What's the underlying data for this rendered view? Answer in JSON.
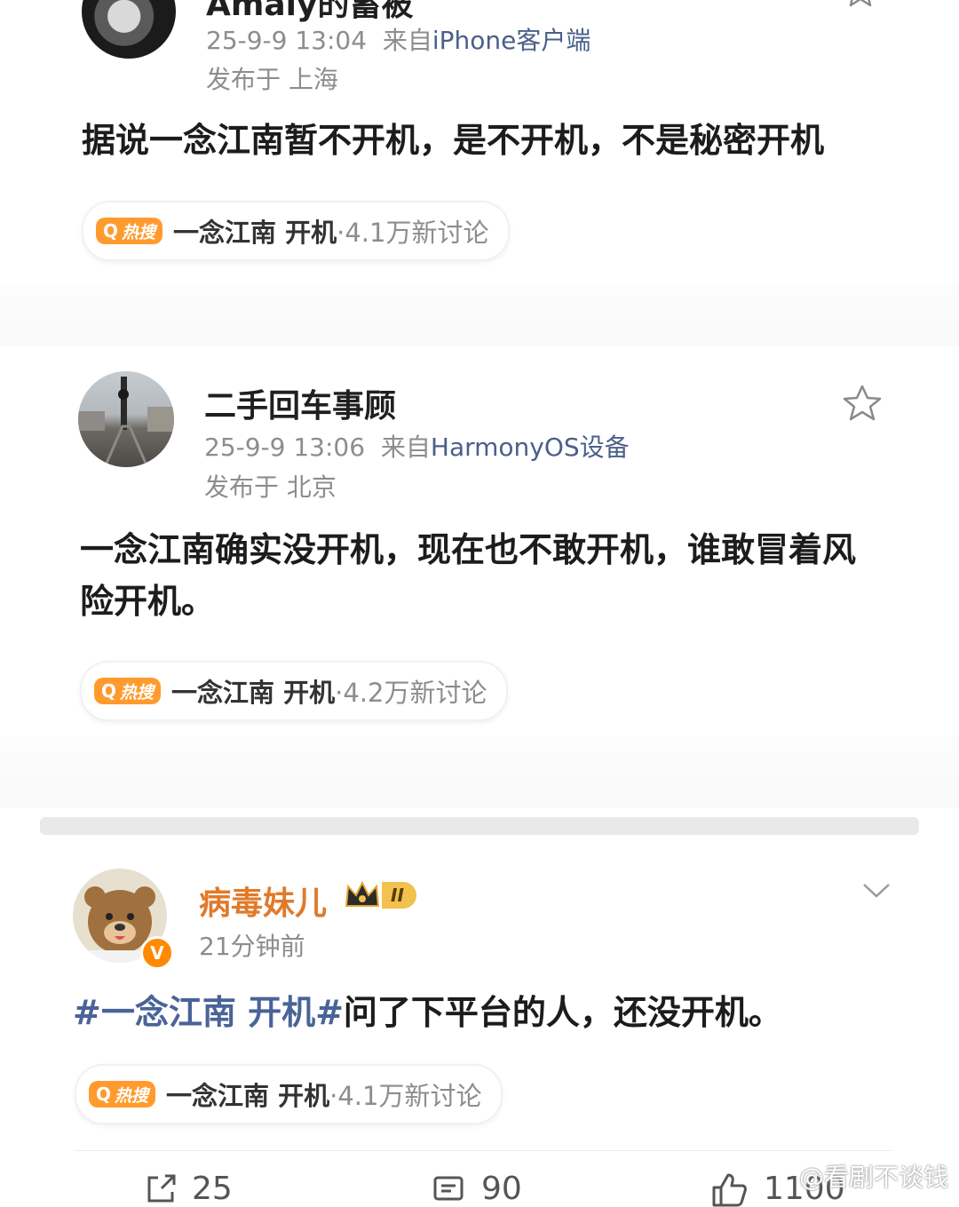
{
  "posts": [
    {
      "name": "Amaly的蓄被",
      "time": "25-9-9 13:04",
      "source_prefix": "来自",
      "source": "iPhone客户端",
      "location": "发布于 上海",
      "content": "据说一念江南暂不开机，是不开机，不是秘密开机",
      "hot_tag": "热搜",
      "hot_topic": "一念江南 开机",
      "hot_count": "·4.1万新讨论"
    },
    {
      "name": "二手回车事顾",
      "time": "25-9-9 13:06",
      "source_prefix": "来自",
      "source": "HarmonyOS设备",
      "location": "发布于 北京",
      "content": "一念江南确实没开机，现在也不敢开机，谁敢冒着风险开机。",
      "hot_tag": "热搜",
      "hot_topic": "一念江南 开机",
      "hot_count": "·4.2万新讨论"
    },
    {
      "name": "病毒妹儿",
      "badge": "II",
      "time": "21分钟前",
      "hashtag": "#一念江南 开机#",
      "content": "问了下平台的人，还没开机。",
      "hot_tag": "热搜",
      "hot_topic": "一念江南 开机",
      "hot_count": "·4.1万新讨论"
    }
  ],
  "actions": {
    "repost": "25",
    "comment": "90",
    "like": "1100"
  },
  "watermark": "@看剧不谈钱",
  "colors": {
    "hot_tag": "#ff9b2e",
    "name_orange": "#e07a2a",
    "hashtag": "#4a6398",
    "source_link": "#4a5f8a"
  }
}
